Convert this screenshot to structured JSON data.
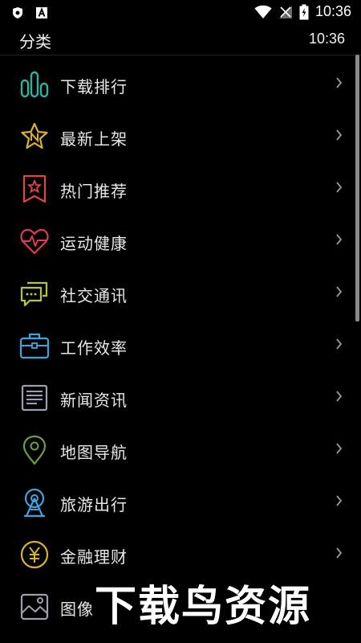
{
  "status_bar": {
    "time": "10:36"
  },
  "header": {
    "title": "分类",
    "time": "10:36"
  },
  "categories": [
    {
      "label": "下载排行",
      "icon": "bar-chart-icon",
      "color": "#2bb3a3"
    },
    {
      "label": "最新上架",
      "icon": "star-n-icon",
      "color": "#d9b230"
    },
    {
      "label": "热门推荐",
      "icon": "bookmark-star-icon",
      "color": "#e04545"
    },
    {
      "label": "运动健康",
      "icon": "heartbeat-icon",
      "color": "#e03a5a"
    },
    {
      "label": "社交通讯",
      "icon": "chat-bubbles-icon",
      "color": "#b6c63a"
    },
    {
      "label": "工作效率",
      "icon": "briefcase-icon",
      "color": "#3aa6e0"
    },
    {
      "label": "新闻资讯",
      "icon": "newspaper-icon",
      "color": "#9aa0b2"
    },
    {
      "label": "地图导航",
      "icon": "map-pin-icon",
      "color": "#6da03a"
    },
    {
      "label": "旅游出行",
      "icon": "ferris-wheel-icon",
      "color": "#3aa6e0"
    },
    {
      "label": "金融理财",
      "icon": "yuan-coin-icon",
      "color": "#d9b230"
    },
    {
      "label": "图像",
      "icon": "image-icon",
      "color": "#9aa0b2"
    }
  ],
  "watermark": {
    "text": "下载鸟资源"
  }
}
